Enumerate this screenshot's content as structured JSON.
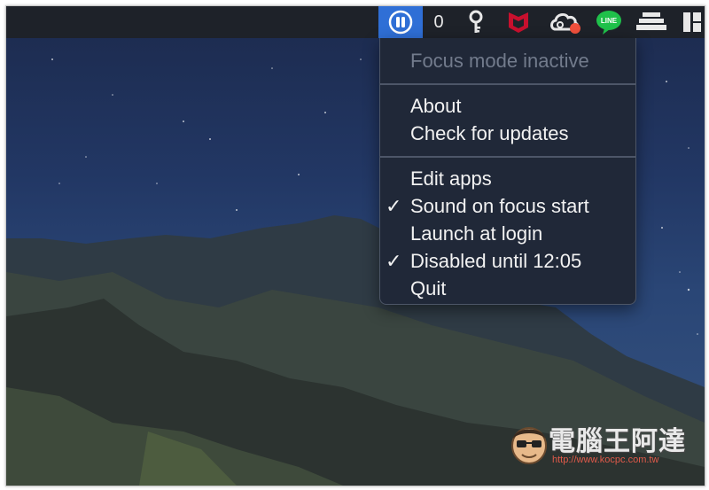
{
  "menubar": {
    "count_value": "0",
    "icons": [
      "focus-pause-icon",
      "key-icon",
      "mcafee-icon",
      "creative-cloud-icon",
      "line-icon",
      "stack-icon",
      "layout-icon"
    ],
    "colors": {
      "bar": "#1e2229",
      "active": "#2f6fd6",
      "line_green": "#1fc14a",
      "mcafee_red": "#c8102e"
    }
  },
  "menu": {
    "status": "Focus mode inactive",
    "about": "About",
    "check_updates": "Check for updates",
    "edit_apps": "Edit apps",
    "sound_on_focus_start": "Sound on focus start",
    "launch_at_login": "Launch at login",
    "disabled_until": "Disabled until 12:05",
    "quit": "Quit",
    "checkmark": "✓",
    "checked": {
      "sound_on_focus_start": true,
      "launch_at_login": false,
      "disabled_until": true
    }
  },
  "line_logo_text": "LINE",
  "watermark": {
    "title": "電腦王阿達",
    "url": "http://www.kocpc.com.tw"
  }
}
